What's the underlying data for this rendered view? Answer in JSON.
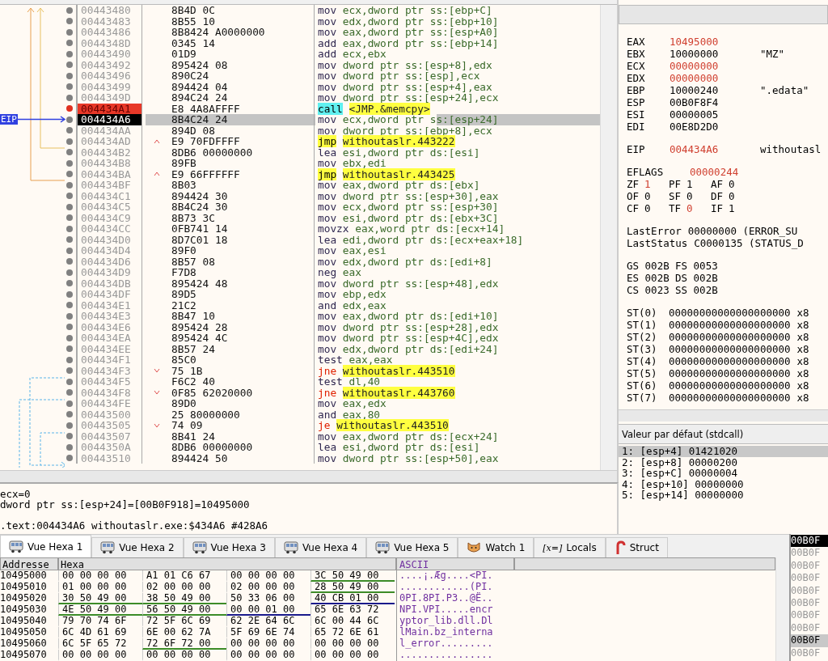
{
  "disassembly": {
    "eip_label": "EIP",
    "rows": [
      {
        "address": "00443480",
        "bytes": "8B4D 0C",
        "mnemonic": "mov",
        "operands": "ecx,dword ptr ss:[ebp+C]",
        "kind": "plain",
        "breakpoint": false,
        "current": false
      },
      {
        "address": "00443483",
        "bytes": "8B55 10",
        "mnemonic": "mov",
        "operands": "edx,dword ptr ss:[ebp+10]",
        "kind": "plain",
        "breakpoint": false,
        "current": false
      },
      {
        "address": "00443486",
        "bytes": "8B8424 A0000000",
        "mnemonic": "mov",
        "operands": "eax,dword ptr ss:[esp+A0]",
        "kind": "plain",
        "breakpoint": false,
        "current": false
      },
      {
        "address": "0044348D",
        "bytes": "0345 14",
        "mnemonic": "add",
        "operands": "eax,dword ptr ss:[ebp+14]",
        "kind": "plain",
        "breakpoint": false,
        "current": false
      },
      {
        "address": "00443490",
        "bytes": "01D9",
        "mnemonic": "add",
        "operands": "ecx,ebx",
        "kind": "plain",
        "breakpoint": false,
        "current": false
      },
      {
        "address": "00443492",
        "bytes": "895424 08",
        "mnemonic": "mov",
        "operands": "dword ptr ss:[esp+8],edx",
        "kind": "plain",
        "breakpoint": false,
        "current": false
      },
      {
        "address": "00443496",
        "bytes": "890C24",
        "mnemonic": "mov",
        "operands": "dword ptr ss:[esp],ecx",
        "kind": "plain",
        "breakpoint": false,
        "current": false
      },
      {
        "address": "00443499",
        "bytes": "894424 04",
        "mnemonic": "mov",
        "operands": "dword ptr ss:[esp+4],eax",
        "kind": "plain",
        "breakpoint": false,
        "current": false
      },
      {
        "address": "0044349D",
        "bytes": "894C24 24",
        "mnemonic": "mov",
        "operands": "dword ptr ss:[esp+24],ecx",
        "kind": "plain",
        "breakpoint": false,
        "current": false
      },
      {
        "address": "004434A1",
        "bytes": "E8 4A8AFFFF",
        "mnemonic": "call",
        "operands": "<JMP.&memcpy>",
        "kind": "call",
        "breakpoint": true,
        "current": false
      },
      {
        "address": "004434A6",
        "bytes": "8B4C24 24",
        "mnemonic": "mov",
        "operands": "ecx,dword ptr ss:[esp+24]",
        "kind": "plain",
        "breakpoint": false,
        "current": true
      },
      {
        "address": "004434AA",
        "bytes": "894D 08",
        "mnemonic": "mov",
        "operands": "dword ptr ss:[ebp+8],ecx",
        "kind": "plain",
        "breakpoint": false,
        "current": false
      },
      {
        "address": "004434AD",
        "bytes": "E9 70FDFFFF",
        "mnemonic": "jmp",
        "operands": "withoutaslr.443222",
        "kind": "jump_up",
        "breakpoint": false,
        "current": false
      },
      {
        "address": "004434B2",
        "bytes": "8DB6 00000000",
        "mnemonic": "lea",
        "operands": "esi,dword ptr ds:[esi]",
        "kind": "plain",
        "breakpoint": false,
        "current": false
      },
      {
        "address": "004434B8",
        "bytes": "89FB",
        "mnemonic": "mov",
        "operands": "ebx,edi",
        "kind": "plain",
        "breakpoint": false,
        "current": false
      },
      {
        "address": "004434BA",
        "bytes": "E9 66FFFFFF",
        "mnemonic": "jmp",
        "operands": "withoutaslr.443425",
        "kind": "jump_up",
        "breakpoint": false,
        "current": false
      },
      {
        "address": "004434BF",
        "bytes": "8B03",
        "mnemonic": "mov",
        "operands": "eax,dword ptr ds:[ebx]",
        "kind": "plain",
        "breakpoint": false,
        "current": false
      },
      {
        "address": "004434C1",
        "bytes": "894424 30",
        "mnemonic": "mov",
        "operands": "dword ptr ss:[esp+30],eax",
        "kind": "plain",
        "breakpoint": false,
        "current": false
      },
      {
        "address": "004434C5",
        "bytes": "8B4C24 30",
        "mnemonic": "mov",
        "operands": "ecx,dword ptr ss:[esp+30]",
        "kind": "plain",
        "breakpoint": false,
        "current": false
      },
      {
        "address": "004434C9",
        "bytes": "8B73 3C",
        "mnemonic": "mov",
        "operands": "esi,dword ptr ds:[ebx+3C]",
        "kind": "plain",
        "breakpoint": false,
        "current": false
      },
      {
        "address": "004434CC",
        "bytes": "0FB741 14",
        "mnemonic": "movzx",
        "operands": "eax,word ptr ds:[ecx+14]",
        "kind": "plain",
        "breakpoint": false,
        "current": false
      },
      {
        "address": "004434D0",
        "bytes": "8D7C01 18",
        "mnemonic": "lea",
        "operands": "edi,dword ptr ds:[ecx+eax+18]",
        "kind": "plain",
        "breakpoint": false,
        "current": false
      },
      {
        "address": "004434D4",
        "bytes": "89F0",
        "mnemonic": "mov",
        "operands": "eax,esi",
        "kind": "plain",
        "breakpoint": false,
        "current": false
      },
      {
        "address": "004434D6",
        "bytes": "8B57 08",
        "mnemonic": "mov",
        "operands": "edx,dword ptr ds:[edi+8]",
        "kind": "plain",
        "breakpoint": false,
        "current": false
      },
      {
        "address": "004434D9",
        "bytes": "F7D8",
        "mnemonic": "neg",
        "operands": "eax",
        "kind": "plain",
        "breakpoint": false,
        "current": false
      },
      {
        "address": "004434DB",
        "bytes": "895424 48",
        "mnemonic": "mov",
        "operands": "dword ptr ss:[esp+48],edx",
        "kind": "plain",
        "breakpoint": false,
        "current": false
      },
      {
        "address": "004434DF",
        "bytes": "89D5",
        "mnemonic": "mov",
        "operands": "ebp,edx",
        "kind": "plain",
        "breakpoint": false,
        "current": false
      },
      {
        "address": "004434E1",
        "bytes": "21C2",
        "mnemonic": "and",
        "operands": "edx,eax",
        "kind": "plain",
        "breakpoint": false,
        "current": false
      },
      {
        "address": "004434E3",
        "bytes": "8B47 10",
        "mnemonic": "mov",
        "operands": "eax,dword ptr ds:[edi+10]",
        "kind": "plain",
        "breakpoint": false,
        "current": false
      },
      {
        "address": "004434E6",
        "bytes": "895424 28",
        "mnemonic": "mov",
        "operands": "dword ptr ss:[esp+28],edx",
        "kind": "plain",
        "breakpoint": false,
        "current": false
      },
      {
        "address": "004434EA",
        "bytes": "895424 4C",
        "mnemonic": "mov",
        "operands": "dword ptr ss:[esp+4C],edx",
        "kind": "plain",
        "breakpoint": false,
        "current": false
      },
      {
        "address": "004434EE",
        "bytes": "8B57 24",
        "mnemonic": "mov",
        "operands": "edx,dword ptr ds:[edi+24]",
        "kind": "plain",
        "breakpoint": false,
        "current": false
      },
      {
        "address": "004434F1",
        "bytes": "85C0",
        "mnemonic": "test",
        "operands": "eax,eax",
        "kind": "plain",
        "breakpoint": false,
        "current": false
      },
      {
        "address": "004434F3",
        "bytes": "75 1B",
        "mnemonic": "jne",
        "operands": "withoutaslr.443510",
        "kind": "cond_jump_down",
        "breakpoint": false,
        "current": false
      },
      {
        "address": "004434F5",
        "bytes": "F6C2 40",
        "mnemonic": "test",
        "operands": "dl,40",
        "kind": "plain",
        "breakpoint": false,
        "current": false
      },
      {
        "address": "004434F8",
        "bytes": "0F85 62020000",
        "mnemonic": "jne",
        "operands": "withoutaslr.443760",
        "kind": "cond_jump_down",
        "breakpoint": false,
        "current": false
      },
      {
        "address": "004434FE",
        "bytes": "89D0",
        "mnemonic": "mov",
        "operands": "eax,edx",
        "kind": "plain",
        "breakpoint": false,
        "current": false
      },
      {
        "address": "00443500",
        "bytes": "25 80000000",
        "mnemonic": "and",
        "operands": "eax,80",
        "kind": "plain",
        "breakpoint": false,
        "current": false
      },
      {
        "address": "00443505",
        "bytes": "74 09",
        "mnemonic": "je",
        "operands": "withoutaslr.443510",
        "kind": "cond_jump_down",
        "breakpoint": false,
        "current": false
      },
      {
        "address": "00443507",
        "bytes": "8B41 24",
        "mnemonic": "mov",
        "operands": "eax,dword ptr ds:[ecx+24]",
        "kind": "plain",
        "breakpoint": false,
        "current": false
      },
      {
        "address": "0044350A",
        "bytes": "8DB6 00000000",
        "mnemonic": "lea",
        "operands": "esi,dword ptr ds:[esi]",
        "kind": "plain",
        "breakpoint": false,
        "current": false
      },
      {
        "address": "00443510",
        "bytes": "894424 50",
        "mnemonic": "mov",
        "operands": "dword ptr ss:[esp+50],eax",
        "kind": "plain",
        "breakpoint": false,
        "current": false
      }
    ]
  },
  "info_pane": {
    "lines": [
      "ecx=0",
      "dword ptr ss:[esp+24]=[00B0F918]=10495000"
    ],
    "location": ".text:004434A6 withoutaslr.exe:$434A6 #428A6"
  },
  "registers": {
    "general": [
      {
        "name": "EAX",
        "value": "10495000",
        "changed": true
      },
      {
        "name": "EBX",
        "value": "10000000",
        "changed": false,
        "comment": "\"MZ\""
      },
      {
        "name": "ECX",
        "value": "00000000",
        "changed": true
      },
      {
        "name": "EDX",
        "value": "00000000",
        "changed": true
      },
      {
        "name": "EBP",
        "value": "10000240",
        "changed": false,
        "comment": "\".edata\""
      },
      {
        "name": "ESP",
        "value": "00B0F8F4",
        "changed": false
      },
      {
        "name": "ESI",
        "value": "00000005",
        "changed": false
      },
      {
        "name": "EDI",
        "value": "00E8D2D0",
        "changed": false
      }
    ],
    "eip": {
      "name": "EIP",
      "value": "004434A6",
      "changed": true,
      "comment": "withoutasl"
    },
    "eflags": {
      "name": "EFLAGS",
      "value": "00000244",
      "changed": true
    },
    "flags": [
      [
        {
          "name": "ZF",
          "value": "1",
          "changed": true
        },
        {
          "name": "PF",
          "value": "1",
          "changed": false
        },
        {
          "name": "AF",
          "value": "0",
          "changed": false
        }
      ],
      [
        {
          "name": "OF",
          "value": "0",
          "changed": false
        },
        {
          "name": "SF",
          "value": "0",
          "changed": false
        },
        {
          "name": "DF",
          "value": "0",
          "changed": false
        }
      ],
      [
        {
          "name": "CF",
          "value": "0",
          "changed": false
        },
        {
          "name": "TF",
          "value": "0",
          "changed": true
        },
        {
          "name": "IF",
          "value": "1",
          "changed": false
        }
      ]
    ],
    "last": [
      {
        "name": "LastError",
        "value": "00000000 (ERROR_SU"
      },
      {
        "name": "LastStatus",
        "value": "C0000135 (STATUS_D"
      }
    ],
    "segments": [
      [
        {
          "name": "GS",
          "value": "002B"
        },
        {
          "name": "FS",
          "value": "0053"
        }
      ],
      [
        {
          "name": "ES",
          "value": "002B"
        },
        {
          "name": "DS",
          "value": "002B"
        }
      ],
      [
        {
          "name": "CS",
          "value": "0023"
        },
        {
          "name": "SS",
          "value": "002B"
        }
      ]
    ],
    "fpu": [
      {
        "name": "ST(0)",
        "value": "00000000000000000000",
        "suffix": "x8"
      },
      {
        "name": "ST(1)",
        "value": "00000000000000000000",
        "suffix": "x8"
      },
      {
        "name": "ST(2)",
        "value": "00000000000000000000",
        "suffix": "x8"
      },
      {
        "name": "ST(3)",
        "value": "00000000000000000000",
        "suffix": "x8"
      },
      {
        "name": "ST(4)",
        "value": "00000000000000000000",
        "suffix": "x8"
      },
      {
        "name": "ST(5)",
        "value": "00000000000000000000",
        "suffix": "x8"
      },
      {
        "name": "ST(6)",
        "value": "00000000000000000000",
        "suffix": "x8"
      },
      {
        "name": "ST(7)",
        "value": "00000000000000000000",
        "suffix": "x8"
      }
    ]
  },
  "call_args": {
    "title": "Valeur par défaut (stdcall)",
    "items": [
      {
        "text": "1: [esp+4] 01421020",
        "selected": true
      },
      {
        "text": "2: [esp+8] 00000200",
        "selected": false
      },
      {
        "text": "3: [esp+C] 00000004",
        "selected": false
      },
      {
        "text": "4: [esp+10] 00000000",
        "selected": false
      },
      {
        "text": "5: [esp+14] 00000000",
        "selected": false
      }
    ]
  },
  "tabs": [
    {
      "label": "Vue Hexa 1",
      "kind": "hex",
      "selected": true
    },
    {
      "label": "Vue Hexa 2",
      "kind": "hex",
      "selected": false
    },
    {
      "label": "Vue Hexa 3",
      "kind": "hex",
      "selected": false
    },
    {
      "label": "Vue Hexa 4",
      "kind": "hex",
      "selected": false
    },
    {
      "label": "Vue Hexa 5",
      "kind": "hex",
      "selected": false
    },
    {
      "label": "Watch 1",
      "kind": "watch",
      "selected": false
    },
    {
      "label": "Locals",
      "kind": "locals",
      "glyph": "[x=]",
      "selected": false
    },
    {
      "label": "Struct",
      "kind": "struct",
      "selected": false
    }
  ],
  "hex_dump": {
    "columns": [
      "Addresse",
      "Hexa",
      "ASCII"
    ],
    "rows": [
      {
        "address": "10495000",
        "groups": [
          {
            "bytes": "00 00 00 00"
          },
          {
            "bytes": "A1 01 C6 67"
          },
          {
            "bytes": "00 00 00 00"
          },
          {
            "bytes": "3C 50 49 00",
            "color": "#3c8c28"
          }
        ],
        "ascii": "....¡.Æg....<PI."
      },
      {
        "address": "10495010",
        "groups": [
          {
            "bytes": "01 00 00 00"
          },
          {
            "bytes": "02 00 00 00"
          },
          {
            "bytes": "02 00 00 00"
          },
          {
            "bytes": "28 50 49 00",
            "color": "#3c8c28"
          }
        ],
        "ascii": "............(PI."
      },
      {
        "address": "10495020",
        "groups": [
          {
            "bytes": "30 50 49 00",
            "color": "#3c8c28"
          },
          {
            "bytes": "38 50 49 00",
            "color": "#3c8c28"
          },
          {
            "bytes": "50 33 06 00"
          },
          {
            "bytes": "40 CB 01 00",
            "color": "#1a1a8c"
          }
        ],
        "ascii": "0PI.8PI.P3..@Ë.."
      },
      {
        "address": "10495030",
        "groups": [
          {
            "bytes": "4E 50 49 00",
            "color": "#3c8c28"
          },
          {
            "bytes": "56 50 49 00",
            "color": "#3c8c28"
          },
          {
            "bytes": "00 00 01 00",
            "color": "#1a1a8c"
          },
          {
            "bytes": "65 6E 63 72"
          }
        ],
        "ascii": "NPI.VPI.....encr"
      },
      {
        "address": "10495040",
        "groups": [
          {
            "bytes": "79 70 74 6F"
          },
          {
            "bytes": "72 5F 6C 69"
          },
          {
            "bytes": "62 2E 64 6C"
          },
          {
            "bytes": "6C 00 44 6C"
          }
        ],
        "ascii": "yptor_lib.dll.Dl"
      },
      {
        "address": "10495050",
        "groups": [
          {
            "bytes": "6C 4D 61 69"
          },
          {
            "bytes": "6E 00 62 7A"
          },
          {
            "bytes": "5F 69 6E 74"
          },
          {
            "bytes": "65 72 6E 61"
          }
        ],
        "ascii": "lMain.bz_interna"
      },
      {
        "address": "10495060",
        "groups": [
          {
            "bytes": "6C 5F 65 72"
          },
          {
            "bytes": "72 6F 72 00",
            "color": "#3c8c28"
          },
          {
            "bytes": "00 00 00 00"
          },
          {
            "bytes": "00 00 00 00"
          }
        ],
        "ascii": "l_error........."
      },
      {
        "address": "10495070",
        "groups": [
          {
            "bytes": "00 00 00 00"
          },
          {
            "bytes": "00 00 00 00"
          },
          {
            "bytes": "00 00 00 00"
          },
          {
            "bytes": "00 00 00 00"
          }
        ],
        "ascii": "................"
      }
    ]
  },
  "stack": {
    "rows": [
      {
        "text": "00B0F",
        "kind": "esp",
        "selected": false
      },
      {
        "text": "00B0F",
        "kind": "plain",
        "selected": false
      },
      {
        "text": "00B0F",
        "kind": "plain",
        "selected": false
      },
      {
        "text": "00B0F",
        "kind": "plain",
        "selected": false
      },
      {
        "text": "00B0F",
        "kind": "plain",
        "selected": false
      },
      {
        "text": "00B0F",
        "kind": "plain",
        "selected": false
      },
      {
        "text": "00B0F",
        "kind": "plain",
        "selected": false
      },
      {
        "text": "00B0F",
        "kind": "plain",
        "selected": false
      },
      {
        "text": "00B0F",
        "kind": "plain",
        "selected": true
      },
      {
        "text": "00B0F",
        "kind": "plain",
        "selected": false
      }
    ]
  }
}
